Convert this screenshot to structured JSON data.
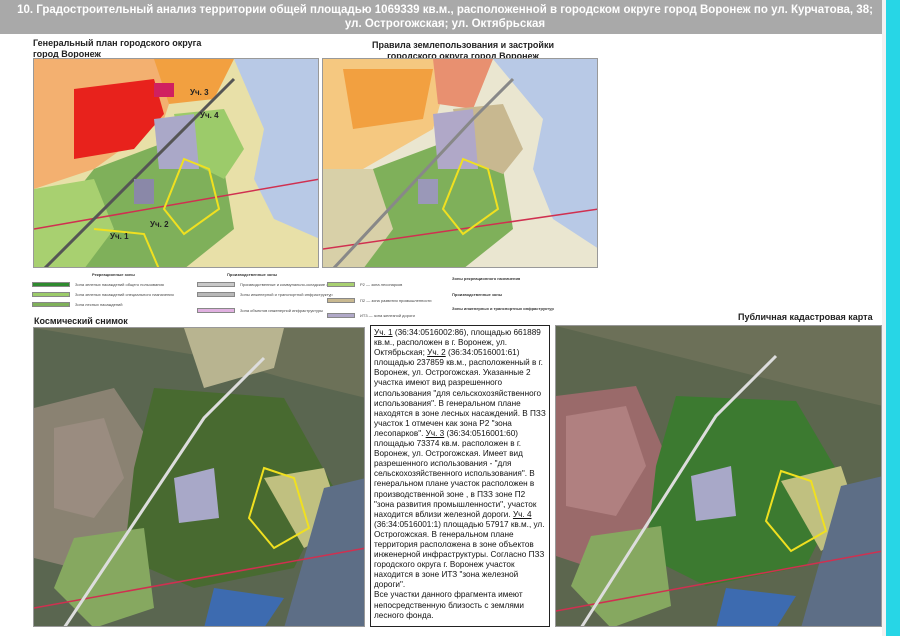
{
  "header": {
    "title": "10. Градостроительный анализ территории общей площадью 1069339 кв.м., расположенной в городском округе город Воронеж по ул. Курчатова, 38; ул. Острогожская; ул. Октябрьская"
  },
  "maps": {
    "general_plan_title": "Генеральный план городского округа город Воронеж",
    "zoning_title": "Правила землепользования и застройки городского округа город Воронеж",
    "satellite_title": "Космический снимок",
    "cadastral_title": "Публичная кадастровая карта",
    "plot_labels": [
      "Уч. 1",
      "Уч. 2",
      "Уч. 3",
      "Уч. 4"
    ]
  },
  "legend_general": {
    "group_recreation": "Рекреационные зоны",
    "group_production": "Производственные зоны",
    "items": [
      "Зона зеленых насаждений общего пользования",
      "Зона зеленых насаждений специального назначения",
      "Зона лесных насаждений",
      "Производственные и коммунально-складские зоны",
      "Зоны инженерной и транспортной инфраструктур",
      "Зона объектов инженерной инфраструктуры"
    ]
  },
  "legend_zoning": {
    "group_recreation": "Зоны рекреационного назначения",
    "group_production": "Производственные зоны",
    "group_transport": "Зоны инженерных и транспортных инфраструктур",
    "items": [
      "Р2 — зона лесопарков",
      "П2 — зона развития промышленности",
      "ИТ3 — зона железной дороги"
    ]
  },
  "info": {
    "p1_label": "Уч. 1",
    "p1_text": " (36:34:0516002:86), площадью 661889 кв.м., расположен в г. Воронеж, ул. Октябрьская; ",
    "p2_label": "Уч. 2",
    "p2_text": " (36:34:0516001:61) площадью 237859 кв.м., расположенный в г. Воронеж, ул. Острогожская. Указанные 2 участка имеют вид разрешенного использования \"для сельскохозяйственного использования\". В генеральном плане находятся в зоне лесных насаждений. В ПЗЗ участок 1 отмечен как зона Р2 \"зона лесопарков\". ",
    "p3_label": "Уч. 3",
    "p3_text": " (36:34:0516001:60) площадью 73374 кв.м. расположен в г. Воронеж, ул. Острогожская. Имеет вид разрешенного использования - \"для сельскохозяйственного использования\". В генеральном плане участок расположен в производственной зоне , в ПЗЗ зоне П2 \"зона развития промышленности\", участок находится вблизи железной дороги. ",
    "p4_label": "Уч. 4",
    "p4_text": " (36:34:0516001:1) площадью 57917 кв.м., ул. Острогожская. В генеральном плане территория расположена в зоне объектов инженерной инфраструктуры. Согласно ПЗЗ городского округа г. Воронеж участок находится в зоне ИТЗ \"зона железной дороги\".",
    "closing": "Все участки данного фрагмента имеют непосредственную близость с землями лесного фонда."
  },
  "colors": {
    "title_bar": "#a9a9a9",
    "accent_strip": "#27d6e6",
    "forest": "#7fb05a",
    "water": "#b8c9e6",
    "industrial_red": "#e8221c",
    "industrial_orange": "#f2a040",
    "plot_outline": "#f0e020"
  }
}
